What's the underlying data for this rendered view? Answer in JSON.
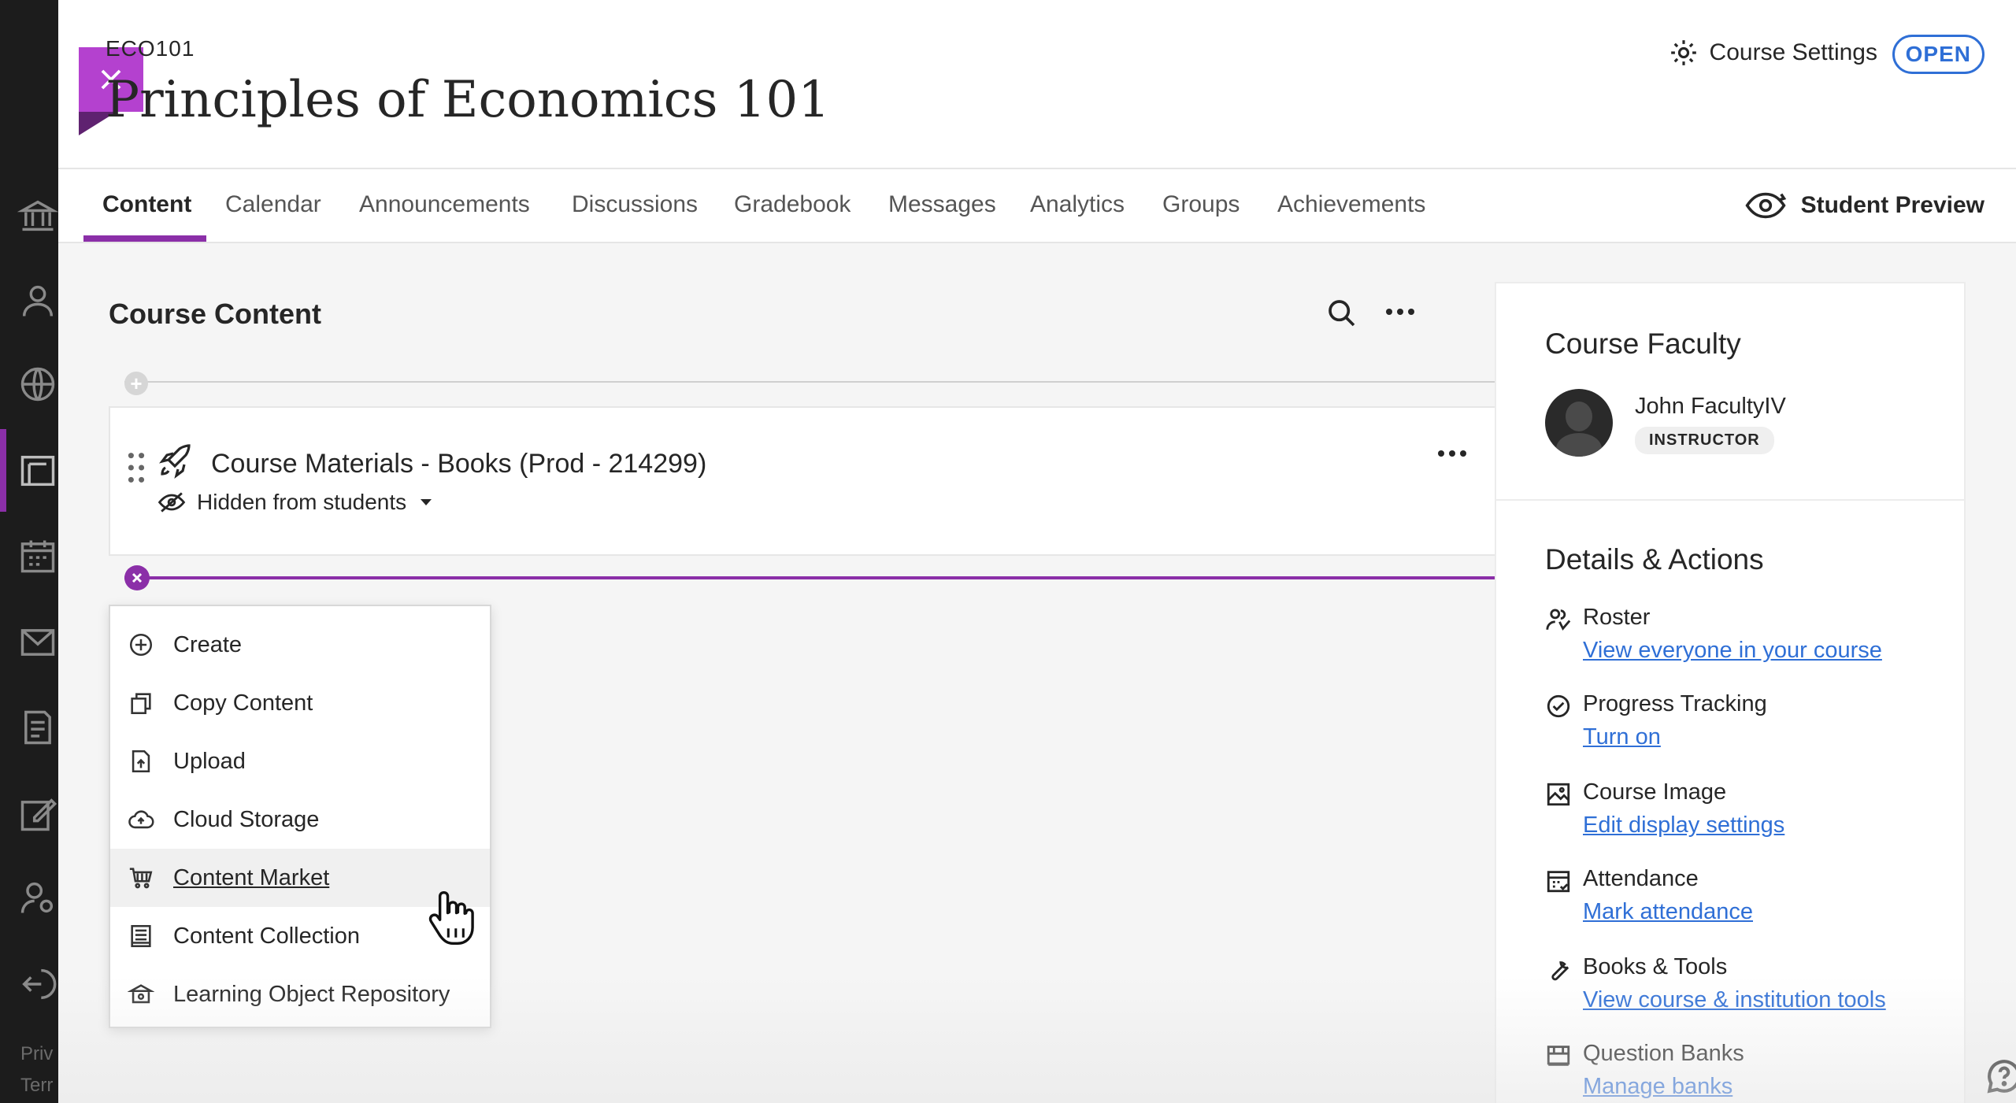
{
  "rail": {
    "items": [
      "institution-icon",
      "profile-icon",
      "globe-icon",
      "courses-icon",
      "calendar-icon",
      "messages-icon",
      "grades-icon",
      "tools-icon",
      "admin-icon",
      "sign-out-icon"
    ],
    "footer_privacy": "Priv",
    "footer_terms": "Terr"
  },
  "header": {
    "course_code": "ECO101",
    "course_title": "Principles of Economics 101",
    "settings_label": "Course Settings",
    "status_badge": "OPEN"
  },
  "tabs": {
    "items": [
      "Content",
      "Calendar",
      "Announcements",
      "Discussions",
      "Gradebook",
      "Messages",
      "Analytics",
      "Groups",
      "Achievements"
    ],
    "active": "Content",
    "student_preview": "Student Preview"
  },
  "content": {
    "title": "Course Content",
    "item": {
      "title": "Course Materials - Books (Prod - 214299)",
      "visibility": "Hidden from students"
    },
    "menu": [
      {
        "label": "Create",
        "icon": "plus-circle-icon"
      },
      {
        "label": "Copy Content",
        "icon": "copy-icon"
      },
      {
        "label": "Upload",
        "icon": "upload-icon"
      },
      {
        "label": "Cloud Storage",
        "icon": "cloud-icon"
      },
      {
        "label": "Content Market",
        "icon": "cart-icon",
        "hovered": true
      },
      {
        "label": "Content Collection",
        "icon": "collection-icon"
      },
      {
        "label": "Learning Object Repository",
        "icon": "repository-icon"
      }
    ]
  },
  "sidebar": {
    "faculty_title": "Course Faculty",
    "faculty_name": "John FacultyIV",
    "faculty_role": "INSTRUCTOR",
    "details_title": "Details & Actions",
    "rows": [
      {
        "label": "Roster",
        "link": "View everyone in your course",
        "icon": "roster-icon"
      },
      {
        "label": "Progress Tracking",
        "link": "Turn on",
        "icon": "check-circle-icon"
      },
      {
        "label": "Course Image",
        "link": "Edit display settings",
        "icon": "image-icon"
      },
      {
        "label": "Attendance",
        "link": "Mark attendance",
        "icon": "attendance-icon"
      },
      {
        "label": "Books & Tools",
        "link": "View course & institution tools",
        "icon": "wrench-icon"
      },
      {
        "label": "Question Banks",
        "link": "Manage banks",
        "icon": "bank-icon"
      }
    ]
  },
  "colors": {
    "accent": "#8b2fa8",
    "close_button": "#b441cf",
    "link": "#2f6fd6",
    "rail": "#1c1c1c"
  }
}
